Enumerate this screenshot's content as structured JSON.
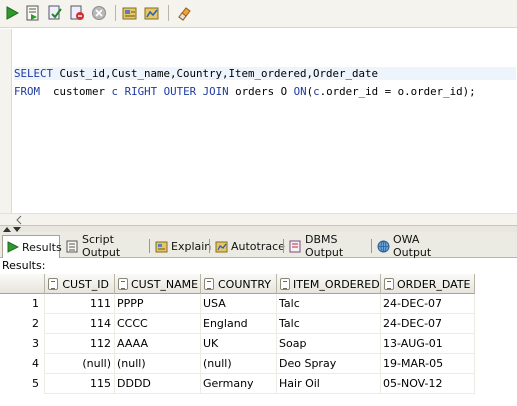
{
  "toolbar": {
    "buttons": [
      {
        "name": "run-statement-button",
        "icon": "play-icon"
      },
      {
        "name": "run-script-button",
        "icon": "script-icon"
      },
      {
        "name": "commit-button",
        "icon": "commit-icon"
      },
      {
        "name": "rollback-button",
        "icon": "rollback-icon"
      },
      {
        "name": "cancel-button",
        "icon": "cancel-icon"
      },
      {
        "name": "sql-tuning-button",
        "icon": "tuning-icon"
      },
      {
        "name": "autotrace-button",
        "icon": "autotrace-icon"
      },
      {
        "name": "clear-button",
        "icon": "eraser-icon"
      }
    ]
  },
  "editor": {
    "line1": {
      "kw1": "SELECT",
      "rest": " Cust_id,Cust_name,Country,Item_ordered,Order_date"
    },
    "line2": {
      "kw1": "FROM",
      "p1": "  customer ",
      "alias1": "c",
      "p2": " ",
      "kw2": "RIGHT OUTER JOIN",
      "p3": " orders ",
      "alias2": "O",
      "p4": " ",
      "kw3": "ON",
      "p5": "(",
      "c": "c",
      "p6": ".order_id = o.order_id);"
    }
  },
  "tabs": [
    {
      "label": "Results",
      "icon": "play-icon",
      "active": true
    },
    {
      "label": "Script Output",
      "icon": "script-output-icon"
    },
    {
      "label": "Explain",
      "icon": "explain-icon"
    },
    {
      "label": "Autotrace",
      "icon": "autotrace-icon"
    },
    {
      "label": "DBMS Output",
      "icon": "dbms-output-icon"
    },
    {
      "label": "OWA Output",
      "icon": "owa-output-icon"
    }
  ],
  "results_label": "Results:",
  "grid": {
    "columns": [
      "CUST_ID",
      "CUST_NAME",
      "COUNTRY",
      "ITEM_ORDERED",
      "ORDER_DATE"
    ],
    "rows": [
      {
        "n": "1",
        "cust_id": "111",
        "cust_name": "PPPP",
        "country": "USA",
        "item": "Talc",
        "date": "24-DEC-07"
      },
      {
        "n": "2",
        "cust_id": "114",
        "cust_name": "CCCC",
        "country": "England",
        "item": "Talc",
        "date": "24-DEC-07"
      },
      {
        "n": "3",
        "cust_id": "112",
        "cust_name": "AAAA",
        "country": "UK",
        "item": "Soap",
        "date": "13-AUG-01"
      },
      {
        "n": "4",
        "cust_id": "(null)",
        "cust_name": "(null)",
        "country": "(null)",
        "item": "Deo Spray",
        "date": "19-MAR-05"
      },
      {
        "n": "5",
        "cust_id": "115",
        "cust_name": "DDDD",
        "country": "Germany",
        "item": "Hair Oil",
        "date": "05-NOV-12"
      }
    ]
  }
}
